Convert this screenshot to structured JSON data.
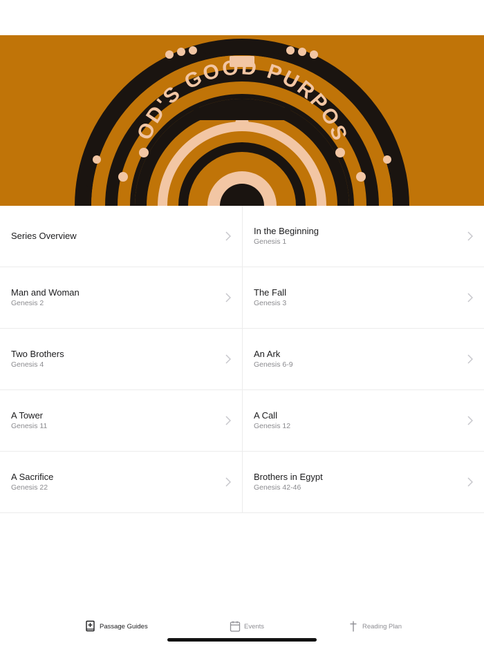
{
  "hero": {
    "banner_text": "GOD'S GOOD PURPOSE",
    "background_color": "#c07408"
  },
  "items": [
    {
      "title": "Series Overview",
      "subtitle": ""
    },
    {
      "title": "In the Beginning",
      "subtitle": "Genesis 1"
    },
    {
      "title": "Man and Woman",
      "subtitle": "Genesis 2"
    },
    {
      "title": "The Fall",
      "subtitle": "Genesis 3"
    },
    {
      "title": "Two Brothers",
      "subtitle": "Genesis 4"
    },
    {
      "title": "An Ark",
      "subtitle": "Genesis 6-9"
    },
    {
      "title": "A Tower",
      "subtitle": "Genesis 11"
    },
    {
      "title": "A Call",
      "subtitle": "Genesis 12"
    },
    {
      "title": "A Sacrifice",
      "subtitle": "Genesis 22"
    },
    {
      "title": "Brothers in Egypt",
      "subtitle": "Genesis 42-46"
    }
  ],
  "tabs": [
    {
      "label": "Passage Guides",
      "icon": "book-plus-icon",
      "active": true
    },
    {
      "label": "Events",
      "icon": "calendar-icon",
      "active": false
    },
    {
      "label": "Reading Plan",
      "icon": "cross-icon",
      "active": false
    }
  ]
}
